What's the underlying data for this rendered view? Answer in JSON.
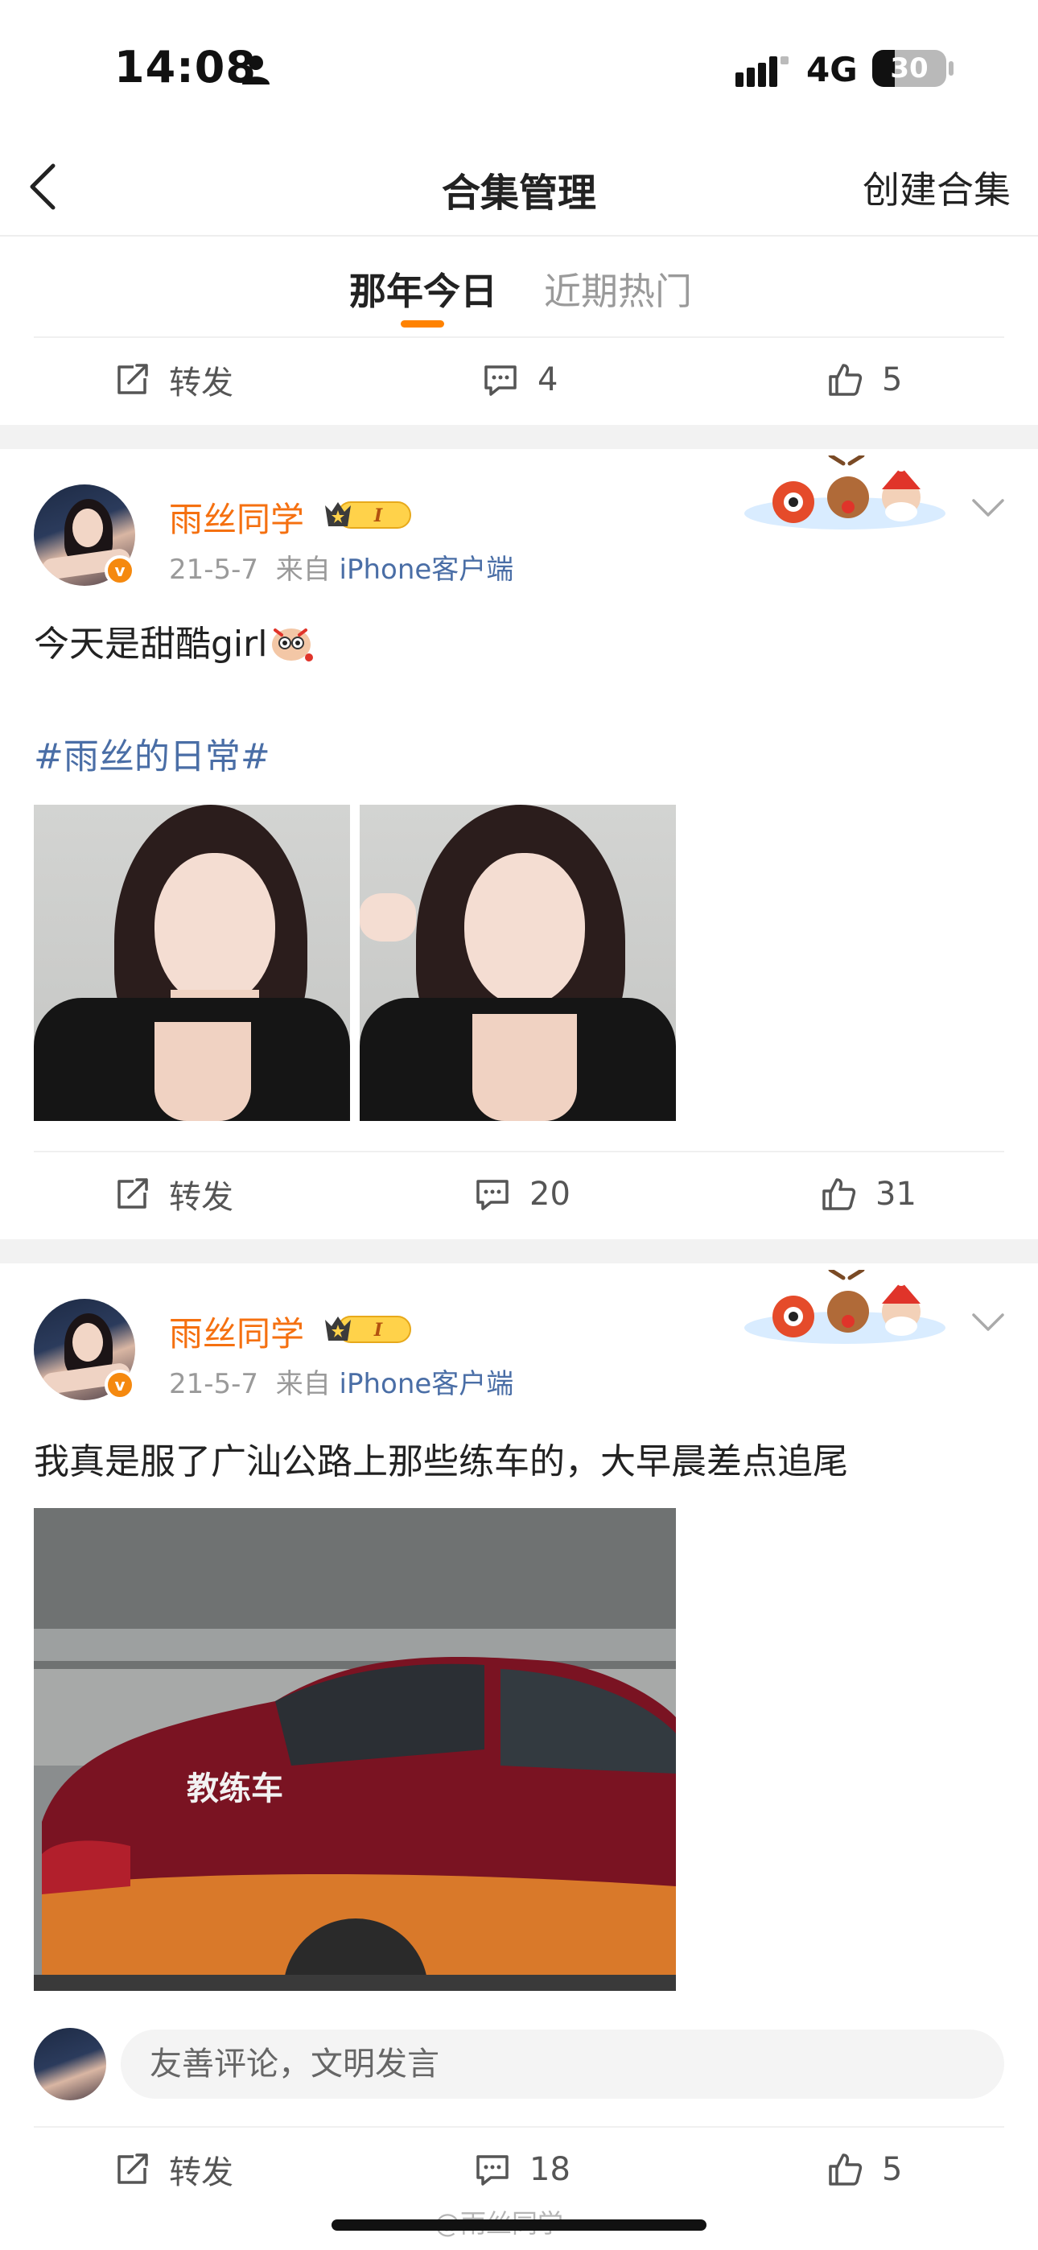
{
  "status_bar": {
    "time": "14:08",
    "network": "4G",
    "battery": "30",
    "battery_level": 0.3
  },
  "nav": {
    "title": "合集管理",
    "action": "创建合集"
  },
  "tabs": [
    {
      "label": "那年今日",
      "active": true
    },
    {
      "label": "近期热门",
      "active": false
    }
  ],
  "top_actions": {
    "repost": "转发",
    "comments": "4",
    "likes": "5"
  },
  "posts": [
    {
      "username": "雨丝同学",
      "vip_level": "I",
      "date": "21-5-7",
      "source_prefix": "来自",
      "source": "iPhone客户端",
      "text": "今天是甜酷girl",
      "hashtag": "#雨丝的日常#",
      "actions": {
        "repost": "转发",
        "comments": "20",
        "likes": "31"
      }
    },
    {
      "username": "雨丝同学",
      "vip_level": "I",
      "date": "21-5-7",
      "source_prefix": "来自",
      "source": "iPhone客户端",
      "text": "我真是服了广汕公路上那些练车的，大早晨差点追尾",
      "car_label": "教练车",
      "actions": {
        "repost": "转发",
        "comments": "18",
        "likes": "5"
      }
    }
  ],
  "comment_box": {
    "placeholder": "友善评论，文明发言"
  },
  "watermark": "@雨丝同学",
  "colors": {
    "accent": "#ff8200",
    "username": "#f57010",
    "link": "#4a6ea6"
  }
}
